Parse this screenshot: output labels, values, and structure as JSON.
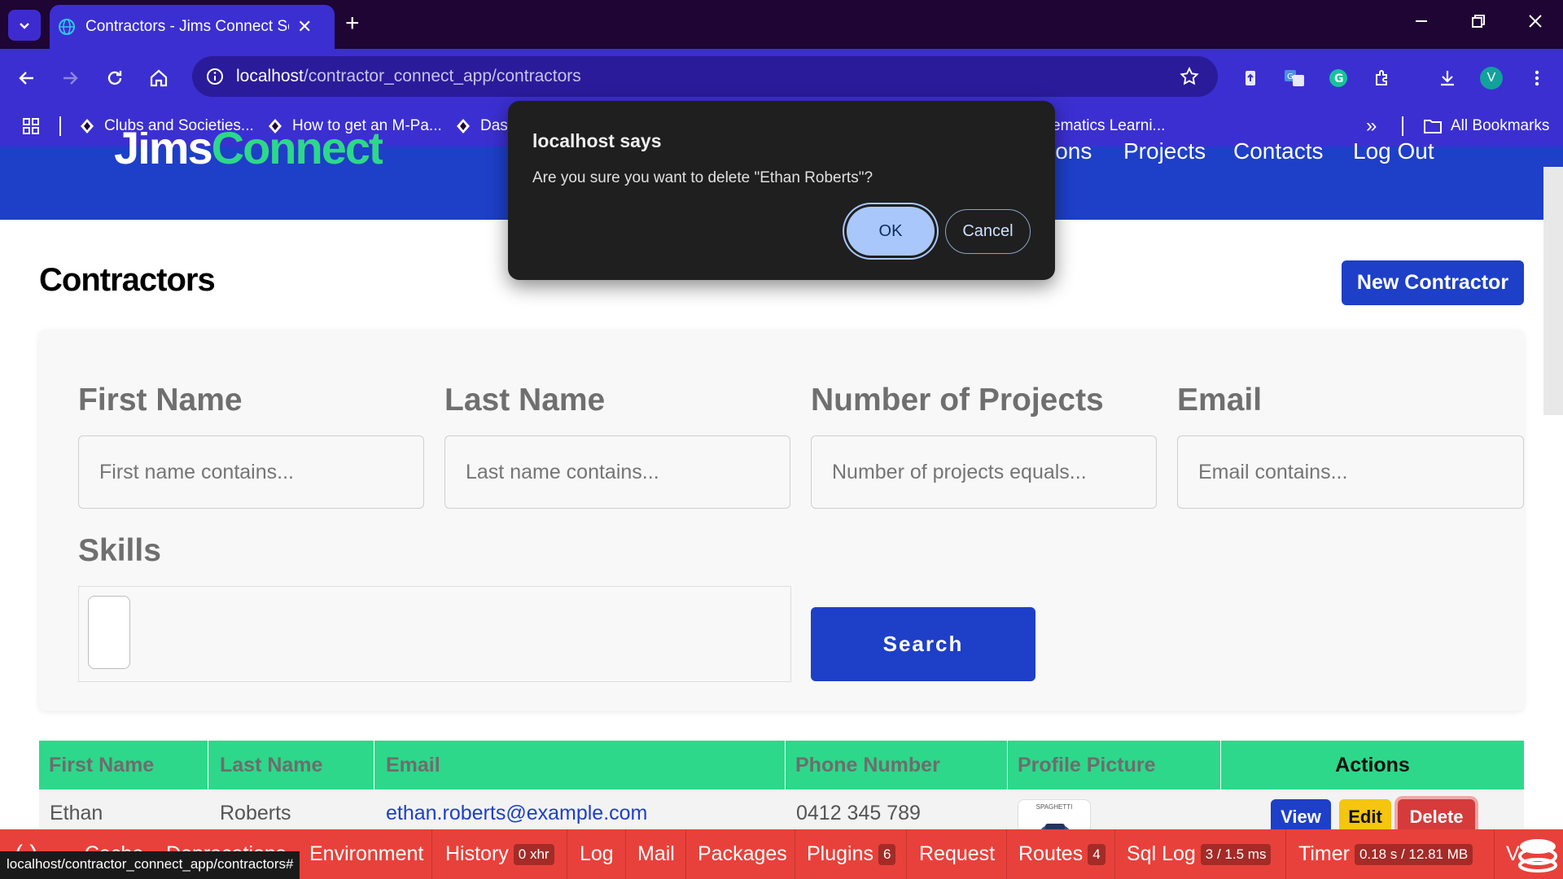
{
  "browser": {
    "tab_title": "Contractors - Jims Connect Solu",
    "tab_close": "✕",
    "new_tab": "+",
    "url_host": "localhost",
    "url_path": "/contractor_connect_app/contractors",
    "profile_initial": "V",
    "bookmarks": [
      "Clubs and Societies...",
      "How to get an M-Pa...",
      "Dash",
      "ematics Learni..."
    ],
    "bookmarks_overflow": "»",
    "all_bookmarks": "All Bookmarks"
  },
  "site": {
    "logo_text": "Jims",
    "logo_accent": "Connect",
    "nav": [
      "ions",
      "Projects",
      "Contacts",
      "Log Out"
    ]
  },
  "page": {
    "title": "Contractors",
    "new_button": "New Contractor"
  },
  "filters": {
    "first_name_label": "First Name",
    "first_name_placeholder": "First name contains...",
    "last_name_label": "Last Name",
    "last_name_placeholder": "Last name contains...",
    "projects_label": "Number of Projects",
    "projects_placeholder": "Number of projects equals...",
    "email_label": "Email",
    "email_placeholder": "Email contains...",
    "skills_label": "Skills",
    "search_button": "Search"
  },
  "table": {
    "headers": [
      "First Name",
      "Last Name",
      "Email",
      "Phone Number",
      "Profile Picture",
      "Actions"
    ],
    "rows": [
      {
        "first": "Ethan",
        "last": "Roberts",
        "email": "ethan.roberts@example.com",
        "phone": "0412 345 789",
        "avatar_caption": "SPAGHETTI"
      }
    ],
    "actions": {
      "view": "View",
      "edit": "Edit",
      "delete": "Delete"
    }
  },
  "debugbar": {
    "items": [
      {
        "label": "Cache"
      },
      {
        "label": "Deprecations"
      },
      {
        "label": "Environment"
      },
      {
        "label": "History",
        "badge": "0 xhr"
      },
      {
        "label": "Log"
      },
      {
        "label": "Mail"
      },
      {
        "label": "Packages"
      },
      {
        "label": "Plugins",
        "badge": "6"
      },
      {
        "label": "Request"
      },
      {
        "label": "Routes",
        "badge": "4"
      },
      {
        "label": "Sql Log",
        "badge": "3 / 1.5 ms"
      },
      {
        "label": "Timer",
        "badge": "0.18 s / 12.81 MB"
      },
      {
        "label": "V"
      }
    ]
  },
  "status_url": "localhost/contractor_connect_app/contractors#",
  "dialog": {
    "title": "localhost says",
    "message": "Are you sure you want to delete \"Ethan Roberts\"?",
    "ok": "OK",
    "cancel": "Cancel"
  },
  "colors": {
    "chrome": "#3b2fd1",
    "brand_blue": "#1e3fc8",
    "brand_green": "#2dd88a",
    "debug_red": "#e8413b"
  }
}
